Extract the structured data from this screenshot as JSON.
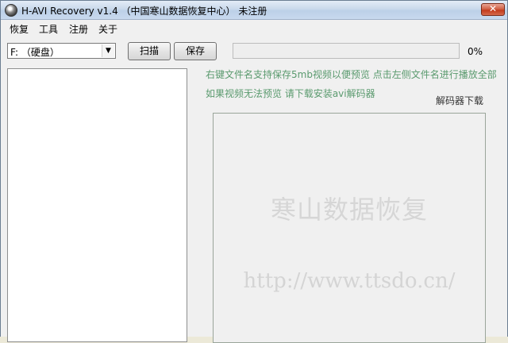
{
  "window": {
    "title": "H-AVI Recovery v1.4 （中国寒山数据恢复中心） 未注册",
    "close_glyph": "✕"
  },
  "menu": [
    {
      "label": "恢复"
    },
    {
      "label": "工具"
    },
    {
      "label": "注册"
    },
    {
      "label": "关于"
    }
  ],
  "toolbar": {
    "drive_selected": "F:  （硬盘）",
    "scan_label": "扫描",
    "save_label": "保存",
    "progress_percent_text": "0%",
    "progress_value": 0
  },
  "hints": {
    "line1": "右键文件名支持保存5mb视频以便预览  点击左侧文件名进行播放全部",
    "line2": "如果视频无法预览  请下载安装avi解码器"
  },
  "decoder_link": "解码器下载",
  "preview": {
    "watermark_main": "寒山数据恢复",
    "watermark_url": "http://www.ttsdo.cn/"
  },
  "colors": {
    "hint_text": "#5a9a6e",
    "watermark": "#d6d6d6",
    "progress_fill": "#37c23a"
  },
  "icons": {
    "app": "app-disc-icon",
    "dropdown": "chevron-down-icon"
  }
}
